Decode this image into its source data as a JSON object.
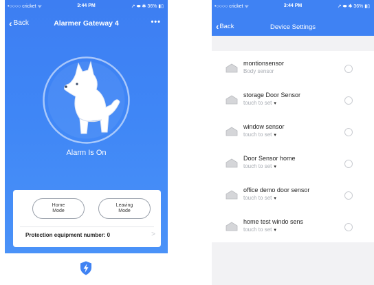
{
  "left": {
    "status": {
      "carrier": "•○○○○ cricket ᯤ",
      "time": "3:44 PM",
      "battery": "↗ ⬬ ✱ 36% ▮▯"
    },
    "nav": {
      "back_label": "Back",
      "title": "Alarmer Gateway 4",
      "more_label": "•••"
    },
    "alarm_status": "Alarm Is On",
    "modes": [
      {
        "line1": "Home",
        "line2": "Mode"
      },
      {
        "line1": "Leaving",
        "line2": "Mode"
      }
    ],
    "protection_label": "Protection equipment number: 0",
    "panel_chevron": ">",
    "colors": {
      "header_blue": "#3f86f6",
      "panel_bg": "#ffffff"
    },
    "icons": [
      "dog-illustration",
      "shield-lightning-icon",
      "chevron-right-icon"
    ]
  },
  "right": {
    "status": {
      "carrier": "•○○○○ cricket ᯤ",
      "time": "3:44 PM",
      "battery": "↗ ⬬ ✱ 36% ▮▯"
    },
    "nav": {
      "back_label": "Back",
      "title": "Device Settings"
    },
    "devices": [
      {
        "name": "montionsensor",
        "subtitle": "Body sensor",
        "has_caret": false
      },
      {
        "name": "storage Door Sensor",
        "subtitle": "touch to set",
        "has_caret": true
      },
      {
        "name": "window sensor",
        "subtitle": "touch to set",
        "has_caret": true
      },
      {
        "name": "Door Sensor home",
        "subtitle": "touch to set",
        "has_caret": true
      },
      {
        "name": "office demo door sensor",
        "subtitle": "touch to set",
        "has_caret": true
      },
      {
        "name": "home test windo sens",
        "subtitle": "touch to set",
        "has_caret": true
      }
    ],
    "caret_glyph": "▾",
    "colors": {
      "header_blue": "#3f82f3",
      "list_bg": "#ffffff",
      "page_bg": "#f2f2f4"
    }
  }
}
